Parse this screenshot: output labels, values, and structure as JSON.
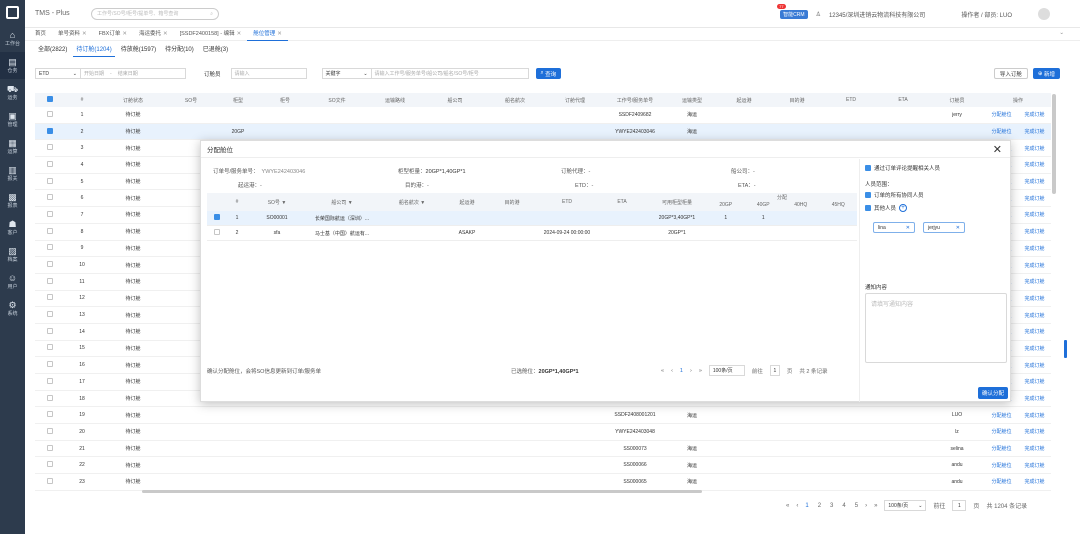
{
  "app": {
    "title": "TMS - Plus"
  },
  "search": {
    "placeholder": "工作号/SO号/柜号/提单号、箱号查询"
  },
  "topbar": {
    "crm_label": "智能CRM",
    "crm_count": "77",
    "company": "12345/深圳进销云物流科技有限公司",
    "operator": "操作者 / 部员: LUO"
  },
  "sidebar": {
    "items": [
      {
        "icon": "home-icon",
        "glyph": "⌂",
        "label": "工作台"
      },
      {
        "icon": "warehouse-icon",
        "glyph": "▤",
        "label": "仓务"
      },
      {
        "icon": "truck-icon",
        "glyph": "⛟",
        "label": "运务"
      },
      {
        "icon": "package-icon",
        "glyph": "▣",
        "label": "管理"
      },
      {
        "icon": "calculator-icon",
        "glyph": "▦",
        "label": "运算"
      },
      {
        "icon": "document-icon",
        "glyph": "▥",
        "label": "报关"
      },
      {
        "icon": "report-icon",
        "glyph": "▩",
        "label": "报表"
      },
      {
        "icon": "users-icon",
        "glyph": "☗",
        "label": "客户"
      },
      {
        "icon": "data-icon",
        "glyph": "▨",
        "label": "档案"
      },
      {
        "icon": "user-icon",
        "glyph": "☺",
        "label": "用户"
      },
      {
        "icon": "gear-icon",
        "glyph": "⚙",
        "label": "系统"
      }
    ]
  },
  "tabs": [
    {
      "label": "首页",
      "closable": false
    },
    {
      "label": "单号资料",
      "closable": true
    },
    {
      "label": "FBX订单",
      "closable": true
    },
    {
      "label": "海运委托",
      "closable": true
    },
    {
      "label": "[SSDF2400158] - 编辑",
      "closable": true
    },
    {
      "label": "舱位管理",
      "closable": true,
      "active": true
    }
  ],
  "subtabs": [
    {
      "label": "全部(2822)"
    },
    {
      "label": "待订舱(1204)",
      "active": true
    },
    {
      "label": "待放舱(1597)"
    },
    {
      "label": "待分配(10)"
    },
    {
      "label": "已退舱(3)"
    }
  ],
  "filters": {
    "date_type": "ETD",
    "start_date": "开始日期",
    "end_date": "结束日期",
    "booker_label": "订舱员",
    "booker_placeholder": "请输入",
    "keyword_type": "关键字",
    "keyword_placeholder": "请输入工作号/服务单号/船公司/船名/SO号/柜号",
    "search_button": "查询",
    "import_button": "导入订舱",
    "add_button": "新增"
  },
  "table": {
    "headers": [
      "#",
      "订舱状态",
      "SO号",
      "柜型",
      "柜号",
      "SO文件",
      "运输路线",
      "船公司",
      "船名航次",
      "订舱代理",
      "工作号/服务单号",
      "运输类型",
      "起运港",
      "目的港",
      "ETD",
      "ETA",
      "订舱员",
      "操作"
    ],
    "action_assign": "分配舱位",
    "action_finish": "完成订舱",
    "rows": [
      {
        "no": "1",
        "status": "待订舱",
        "so": "",
        "type": "",
        "job": "SSDF2409682",
        "trans": "海运",
        "booker": "jerry"
      },
      {
        "no": "2",
        "status": "待订舱",
        "so": "",
        "type": "20GP",
        "job": "YWYE242403046",
        "trans": "海运",
        "booker": "",
        "selected": true
      },
      {
        "no": "3",
        "status": "待订舱",
        "so": "",
        "type": "",
        "job": "",
        "trans": "",
        "booker": ""
      },
      {
        "no": "4",
        "status": "待订舱",
        "so": "",
        "type": "",
        "job": "",
        "trans": "",
        "booker": ""
      },
      {
        "no": "5",
        "status": "待订舱",
        "so": "",
        "type": "",
        "job": "",
        "trans": "",
        "booker": ""
      },
      {
        "no": "6",
        "status": "待订舱",
        "so": "",
        "type": "",
        "job": "",
        "trans": "",
        "booker": ""
      },
      {
        "no": "7",
        "status": "待订舱",
        "so": "",
        "type": "",
        "job": "",
        "trans": "",
        "booker": ""
      },
      {
        "no": "8",
        "status": "待订舱",
        "so": "",
        "type": "",
        "job": "",
        "trans": "",
        "booker": ""
      },
      {
        "no": "9",
        "status": "待订舱",
        "so": "",
        "type": "",
        "job": "",
        "trans": "",
        "booker": ""
      },
      {
        "no": "10",
        "status": "待订舱",
        "so": "",
        "type": "",
        "job": "",
        "trans": "",
        "booker": ""
      },
      {
        "no": "11",
        "status": "待订舱",
        "so": "",
        "type": "",
        "job": "",
        "trans": "",
        "booker": ""
      },
      {
        "no": "12",
        "status": "待订舱",
        "so": "",
        "type": "",
        "job": "",
        "trans": "",
        "booker": ""
      },
      {
        "no": "13",
        "status": "待订舱",
        "so": "",
        "type": "",
        "job": "",
        "trans": "",
        "booker": ""
      },
      {
        "no": "14",
        "status": "待订舱",
        "so": "",
        "type": "",
        "job": "",
        "trans": "",
        "booker": ""
      },
      {
        "no": "15",
        "status": "待订舱",
        "so": "",
        "type": "",
        "job": "",
        "trans": "",
        "booker": ""
      },
      {
        "no": "16",
        "status": "待订舱",
        "so": "",
        "type": "",
        "job": "",
        "trans": "",
        "booker": ""
      },
      {
        "no": "17",
        "status": "待订舱",
        "so": "",
        "type": "",
        "job": "",
        "trans": "",
        "booker": ""
      },
      {
        "no": "18",
        "status": "待订舱",
        "so": "",
        "type": "",
        "job": "",
        "trans": "",
        "booker": ""
      },
      {
        "no": "19",
        "status": "待订舱",
        "so": "",
        "type": "",
        "job": "SSDF2408001201",
        "trans": "海运",
        "booker": "LUO"
      },
      {
        "no": "20",
        "status": "待订舱",
        "so": "",
        "type": "",
        "job": "YWYE242403048",
        "trans": "",
        "booker": "lz"
      },
      {
        "no": "21",
        "status": "待订舱",
        "so": "",
        "type": "",
        "job": "SS000073",
        "trans": "海运",
        "booker": "selina"
      },
      {
        "no": "22",
        "status": "待订舱",
        "so": "",
        "type": "",
        "job": "SS000066",
        "trans": "海运",
        "booker": "andu"
      },
      {
        "no": "23",
        "status": "待订舱",
        "so": "",
        "type": "",
        "job": "SS000065",
        "trans": "海运",
        "booker": "andu"
      }
    ]
  },
  "pager": {
    "pages": [
      "1",
      "2",
      "3",
      "4",
      "5"
    ],
    "current": "1",
    "per_page": "100条/页",
    "goto_label": "前往",
    "goto_value": "1",
    "goto_suffix": "页",
    "total": "共 1204 条记录"
  },
  "modal": {
    "title": "分配舱位",
    "order_label": "订单号/服务单号：",
    "order_value": "YWYE242403046",
    "qty_label": "柜型柜量：",
    "qty_value": "20GP*1,40GP*1",
    "agent_label": "订舱代理：",
    "agent_value": "-",
    "carrier_label": "船公司：",
    "carrier_value": "-",
    "pol_label": "起运港：",
    "pol_value": "-",
    "pod_label": "目的港：",
    "pod_value": "-",
    "etd_label": "ETD：",
    "etd_value": "-",
    "eta_label": "ETA：",
    "eta_value": "-",
    "headers": [
      "#",
      "SO号",
      "船公司",
      "船名航次",
      "起运港",
      "目的港",
      "ETD",
      "ETA",
      "可用柜型柜量"
    ],
    "alloc_header": "分配",
    "alloc_types": [
      "20GP",
      "40GP",
      "40HQ",
      "45HQ"
    ],
    "rows": [
      {
        "no": "1",
        "so": "SO00001",
        "carrier": "长荣国际航运（深圳）...",
        "voyage": "",
        "pol": "",
        "pod": "",
        "etd": "",
        "eta": "",
        "avail": "20GP*3,40GP*1",
        "a20": "1",
        "a40": "1",
        "a40hq": "",
        "a45": "",
        "checked": true
      },
      {
        "no": "2",
        "so": "sfa",
        "carrier": "马士基（中国）航运有...",
        "voyage": "",
        "pol": "ASAKP",
        "pod": "",
        "etd": "2024-09-24 00:00:00",
        "eta": "",
        "avail": "20GP*1",
        "a20": "",
        "a40": "",
        "a40hq": "",
        "a45": "",
        "checked": false
      }
    ],
    "footer_note": "确认分配舱位，会将SO信息更新到订单/服务单",
    "selected_label": "已选舱位：",
    "selected_value": "20GP*1,40GP*1",
    "pager": {
      "page": "1",
      "per_page": "100条/页",
      "goto_label": "前往",
      "goto_value": "1",
      "goto_suffix": "页",
      "total": "共 2 条记录"
    },
    "right": {
      "notify_label": "通过订单评论提醒相关人员",
      "scope_label": "人员范围：",
      "all_people": "订单的所有协同人员",
      "other_people": "其他人员",
      "tags": [
        "lina",
        "jerjyu"
      ],
      "content_label": "通知内容",
      "content_placeholder": "请填写通知内容",
      "confirm": "确认分配"
    }
  }
}
